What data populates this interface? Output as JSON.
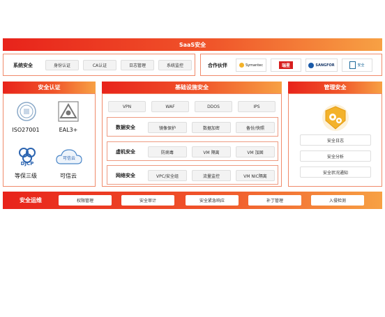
{
  "saas": {
    "title": "SaaS安全"
  },
  "system_security": {
    "label": "系统安全",
    "items": [
      "身份认证",
      "CA认证",
      "日志管理",
      "系统监控"
    ]
  },
  "partners": {
    "label": "合作伙伴",
    "logos": [
      "Symantec",
      "瑞星",
      "SANGFOR",
      "安全"
    ]
  },
  "auth": {
    "title": "安全认证",
    "certs": [
      {
        "name": "ISO27001",
        "icon": "iso-seal-icon"
      },
      {
        "name": "EAL3+",
        "icon": "eal-triangle-icon"
      },
      {
        "name": "等保三级",
        "icon": "djcp-icon",
        "badge": "DJCP"
      },
      {
        "name": "可信云",
        "icon": "cloud-icon",
        "badge": "可信云"
      }
    ]
  },
  "infra": {
    "title": "基础设施安全",
    "top": [
      "VPN",
      "WAF",
      "DDOS",
      "IPS"
    ],
    "rows": [
      {
        "label": "数据安全",
        "items": [
          "镜像保护",
          "数据加密",
          "备份/快照"
        ]
      },
      {
        "label": "虚机安全",
        "items": [
          "防病毒",
          "VM 隔离",
          "VM 加固"
        ]
      },
      {
        "label": "网络安全",
        "items": [
          "VPC/安全组",
          "流量监控",
          "VM NIC隔离"
        ]
      }
    ]
  },
  "mgmt": {
    "title": "管理安全",
    "items": [
      "安全日志",
      "安全分析",
      "安全状况通知"
    ]
  },
  "ops": {
    "label": "安全运维",
    "items": [
      "权限管理",
      "安全审计",
      "安全紧急响应",
      "补丁管理",
      "入侵检测"
    ]
  },
  "colors": {
    "accent_red": "#e8231b",
    "accent_orange": "#f7a144",
    "gold": "#f3b22a"
  }
}
